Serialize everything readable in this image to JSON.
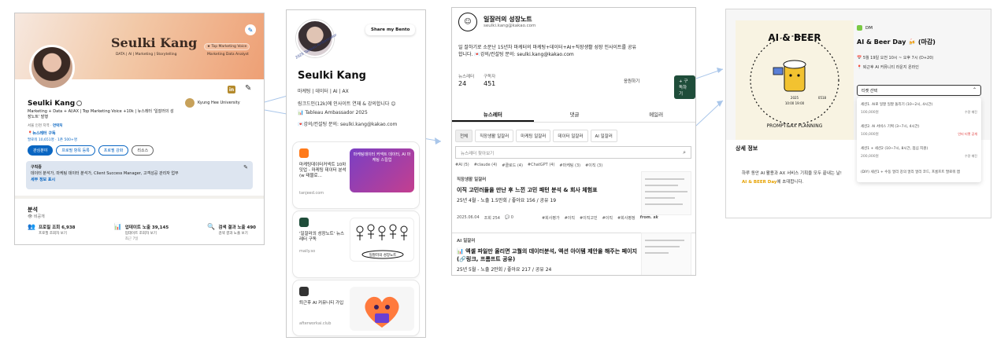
{
  "linkedin": {
    "banner_name": "Seulki Kang",
    "banner_sub": "DATA | AI | Marketing | Storytelling",
    "banner_badge": "★ Top Marketing Voice",
    "banner_badge2": "Marketing Data Analyst",
    "name": "Seulki Kang",
    "headline": "Marketing + Data + AI/AX | Top Marketing Voice +10k | 뉴스레터 '일잘러의 성장노트' 발행",
    "location_prefix": "서울 인천 지역 · ",
    "location_link": "연락처",
    "newsletter": "📍뉴스레터 구독",
    "followers": "팔로워 10,651명 · 1촌 500+명",
    "school": "Kyung Hee University",
    "li_icon": "in",
    "buttons": [
      "관심분야",
      "프로필 항목 등록",
      "프로필 강화",
      "리소스"
    ],
    "open_box": {
      "title": "구직중",
      "desc": "데이터 분석가, 마케팅 데이터 분석가, Client Success Manager, 고객성공 관리자 업무",
      "link": "세부 정보 표시"
    },
    "analytics": {
      "title": "분석",
      "sub": "👁 비공개",
      "stats": [
        {
          "icon": "people-icon",
          "glyph": "👥",
          "value": "프로필 조회 6,938",
          "sub": "프로필 조회자 보기",
          "sub2": ""
        },
        {
          "icon": "chart-icon",
          "glyph": "📊",
          "value": "업데이트 노출 39,145",
          "sub": "업데이트 조회자 보기",
          "sub2": "최근 7일"
        },
        {
          "icon": "search-icon",
          "glyph": "🔍",
          "value": "검색 결과 노출 490",
          "sub": "검색 결과 노출 보기",
          "sub2": ""
        }
      ]
    }
  },
  "bento": {
    "share": "Share my Bento",
    "ring_text": "2025 Tableau Ambassador",
    "name": "Seulki Kang",
    "roles": "마케팅 | 데이터 | AI | AX",
    "lines": [
      "링크드인(12k)에 인사이트 연재 & 강의합니다 😊",
      "📊 Tableau Ambassador 2025",
      "💌강의/컨설팅 문의: seulki.kang@kakao.com"
    ],
    "cards": [
      {
        "title": "마케팅데이터커넥트 10차 밋업 - 마케팅 데이터 분석 (w 태블로...",
        "url": "tanjeed.com",
        "thumb": "마케팅데이터 커넥트 데이터, AI 마케팅 스킬업"
      },
      {
        "title": "'일잘러의 성장노트' 뉴스레터 구독",
        "url": "maily.so",
        "thumb": "일잘러의 성장노트"
      },
      {
        "title": "퇴근후 AI 커뮤니티 가입",
        "url": "afterworkai.club",
        "thumb": ""
      }
    ]
  },
  "newsletter": {
    "logo": "☺",
    "title": "일잘러의 성장노트",
    "email": "seulki.kang@kakao.com",
    "intro": "일 잘하기로 소문난 15년차 마케터의 마케팅+데이터+AI+직장생활 성장 인사이트를 공유합니다. 💌강의/컨설팅 문의: seulki.kang@kakao.com",
    "counts": [
      {
        "label": "뉴스레터",
        "value": "24"
      },
      {
        "label": "구독자",
        "value": "451"
      }
    ],
    "ask_label": "응원하기",
    "subscribe_label": "+ 구독하기",
    "tabs": [
      "뉴스레터",
      "댓글",
      "메일러"
    ],
    "chips": [
      "전체",
      "직장생활 일잘러",
      "마케팅 일잘러",
      "데이터 일잘러",
      "AI 일잘러"
    ],
    "search_placeholder": "뉴스레터 찾아보기",
    "tags": [
      "#AI (5)",
      "#claude (4)",
      "#클로드 (4)",
      "#ChatGPT (4)",
      "#마케팅 (3)",
      "#이직 (3)"
    ],
    "posts": [
      {
        "category": "직장생활 일잘러",
        "title": "이직 고민러들을 만난 후 느낀 고민 패턴 분석 & 회사 체험표",
        "meta": "25년 4월 - 노출 1.5만회 / 좋아요 156 / 공유 19"
      },
      {
        "category": "AI 일잘러",
        "title": "📊 엑셀 파일만 올리면 고퀄의 데이터분석, 액션 아이템 제안을 해주는 페이지 (🔗링크, 프롬프트 공유)",
        "meta": "25년 5월 - 노출 2만회 / 좋아요 217 / 공유 24"
      }
    ],
    "post_meta": {
      "date": "2025.06.04",
      "views": "조회 254",
      "comments": "💬 0",
      "tags": [
        "#회사평가",
        "#이직",
        "#이직고민",
        "#이직",
        "#회사평정"
      ],
      "from": "from. sk"
    }
  },
  "event": {
    "host": "DM",
    "title": "AI & Beer Day 🍻 (마감)",
    "date": "📅 5월 19일 오전 10시 ~ 오후 7시 (D+20)",
    "place": "📍 퇴근후 AI 커뮤니티 라운지 온라인",
    "select_label": "티켓 선택",
    "options": [
      {
        "label": "세션1. AI로 일잘 일잘 돌리기 (10~2시, 4시간)",
        "price": "100,000원",
        "status": "수량 매진",
        "red": false
      },
      {
        "label": "세션2. AI 서비스 기획 (3~7시, 4시간)",
        "price": "100,000원",
        "status": "인터 티켓 공개",
        "red": true
      },
      {
        "label": "세션1 + 세션2 (10~7시, 8시간, 점심 지원)",
        "price": "200,000원",
        "status": "수량 매진",
        "red": false
      },
      {
        "label": "(DIY) 세션1 + 수동 얼리 강의 얼리 얼리 코드, 프롬프트 팔로워 앱",
        "price": "",
        "status": "",
        "red": false
      }
    ],
    "detail_title": "상세 정보",
    "desc1": "하루 동안 AI 활용과 AX 서비스 기획을 모두 끝내는 날!",
    "desc2_hl": "AI & BEER Day",
    "desc2": "에 초대합니다.",
    "poster": {
      "title": "AI & BEER",
      "sub": "PROMPT&AX PLANNING",
      "year": "2025",
      "date": "0518",
      "time": "10:00 19:00"
    }
  },
  "colors": {
    "linkedin_blue": "#0a66c2",
    "maily_green": "#1f4d3a",
    "connector": "#a9c6ea",
    "highlight": "#e6a100"
  }
}
